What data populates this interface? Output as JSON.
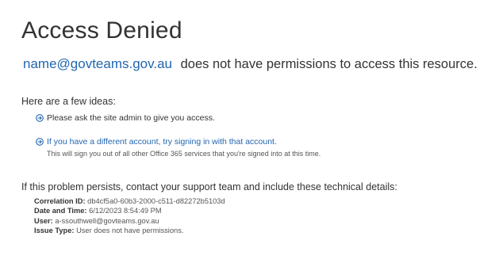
{
  "page": {
    "title": "Access Denied"
  },
  "message": {
    "user_email": "name@govteams.gov.au",
    "text": "does not have permissions to access this resource."
  },
  "ideas": {
    "heading": "Here are a few ideas:",
    "items": [
      {
        "text": "Please ask the site admin to give you access.",
        "is_link": false
      },
      {
        "text": "If you have a different account, try signing in with that account.",
        "is_link": true,
        "note": "This will sign you out of all other Office 365 services that you're signed into at this time."
      }
    ]
  },
  "support": {
    "text": "If this problem persists, contact your support team and include these technical details:",
    "details": [
      {
        "label": "Correlation ID:",
        "value": "db4cf5a0-60b3-2000-c511-d82272b5103d"
      },
      {
        "label": "Date and Time:",
        "value": "6/12/2023 8:54:49 PM"
      },
      {
        "label": "User:",
        "value": "a-ssouthwell@govteams.gov.au"
      },
      {
        "label": "Issue Type:",
        "value": "User does not have permissions."
      }
    ]
  },
  "icons": {
    "idea_bullet": "circle-arrow-right-icon"
  },
  "colors": {
    "link": "#2266b0",
    "text": "#333333"
  }
}
